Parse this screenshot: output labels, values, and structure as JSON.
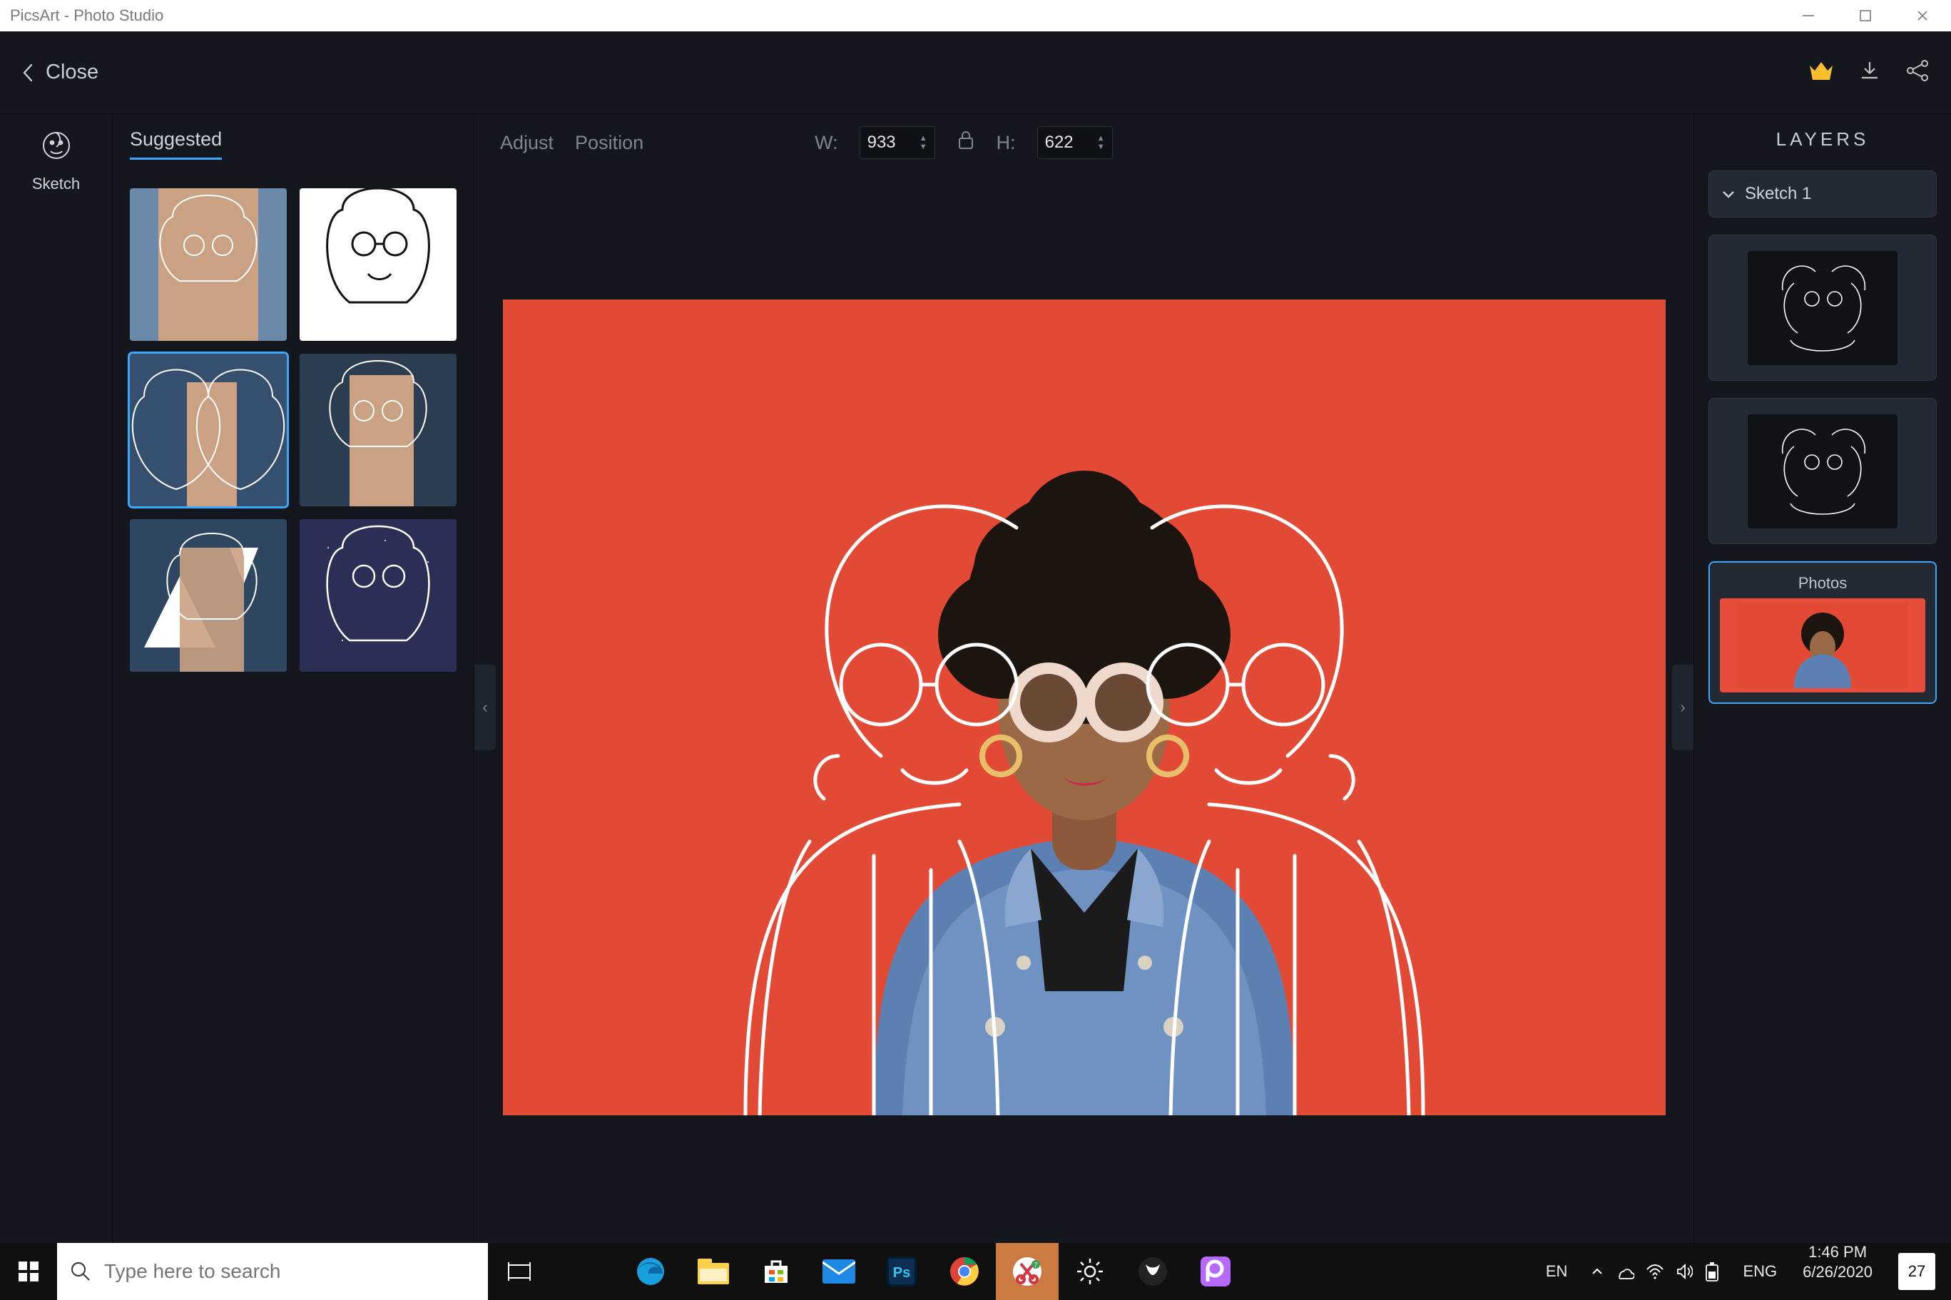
{
  "window": {
    "title": "PicsArt - Photo Studio"
  },
  "topbar": {
    "close": "Close"
  },
  "toolrail": {
    "active": "Sketch"
  },
  "suggested": {
    "title": "Suggested"
  },
  "props": {
    "adjust": "Adjust",
    "position": "Position",
    "wlabel": "W:",
    "hlabel": "H:",
    "w": "933",
    "h": "622"
  },
  "layers": {
    "title": "LAYERS",
    "sketch": "Sketch 1",
    "photos": "Photos"
  },
  "search": {
    "placeholder": "Type here to search"
  },
  "tray": {
    "lang1": "EN",
    "lang2": "ENG",
    "time": "1:46 PM",
    "date": "6/26/2020",
    "badge": "27"
  }
}
